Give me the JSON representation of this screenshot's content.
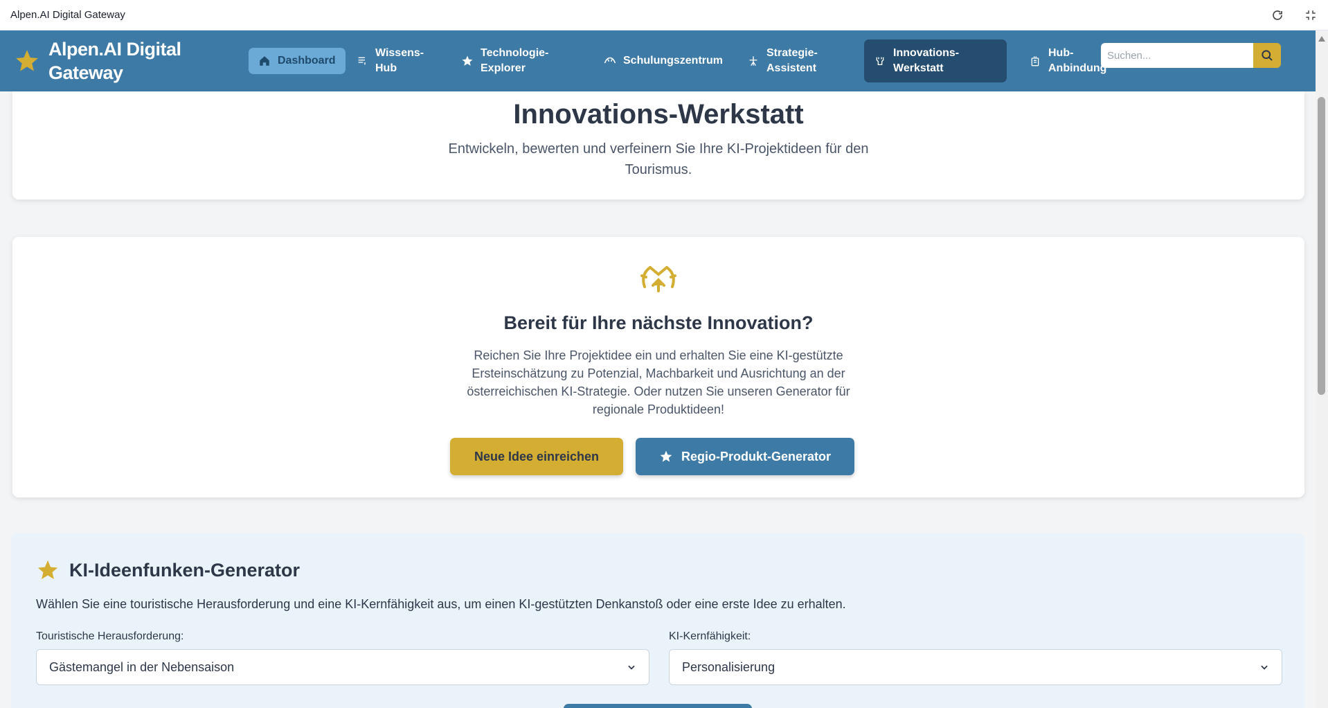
{
  "window": {
    "title": "Alpen.AI Digital Gateway"
  },
  "brand": {
    "name": "Alpen.AI Digital Gateway"
  },
  "nav": {
    "items": [
      {
        "label": "Dashboard",
        "icon": "home-icon"
      },
      {
        "label": "Wissens-Hub",
        "icon": "book-icon"
      },
      {
        "label": "Technologie-Explorer",
        "icon": "star-icon"
      },
      {
        "label": "Schulungszentrum",
        "icon": "graduation-icon"
      },
      {
        "label": "Strategie-Assistent",
        "icon": "compass-icon"
      },
      {
        "label": "Innovations-Werkstatt",
        "icon": "workshop-icon"
      },
      {
        "label": "Hub-Anbindung",
        "icon": "link-icon"
      }
    ]
  },
  "search": {
    "placeholder": "Suchen..."
  },
  "hero": {
    "title": "Innovations-Werkstatt",
    "subtitle": "Entwickeln, bewerten und verfeinern Sie Ihre KI-Projektideen für den Tourismus."
  },
  "cta": {
    "title": "Bereit für Ihre nächste Innovation?",
    "text": "Reichen Sie Ihre Projektidee ein und erhalten Sie eine KI-gestützte Ersteinschätzung zu Potenzial, Machbarkeit und Ausrichtung an der österreichischen KI-Strategie. Oder nutzen Sie unseren Generator für regionale Produktideen!",
    "primary_button": "Neue Idee einreichen",
    "secondary_button": "Regio-Produkt-Generator"
  },
  "generator": {
    "title": "KI-Ideenfunken-Generator",
    "description": "Wählen Sie eine touristische Herausforderung und eine KI-Kernfähigkeit aus, um einen KI-gestützten Denkanstoß oder eine erste Idee zu erhalten.",
    "challenge_label": "Touristische Herausforderung:",
    "challenge_value": "Gästemangel in der Nebensaison",
    "capability_label": "KI-Kernfähigkeit:",
    "capability_value": "Personalisierung"
  },
  "colors": {
    "navbar": "#3d7aa6",
    "accent_gold": "#d4ae32",
    "active_nav": "#254d70",
    "generator_bg": "#eaf3f9"
  }
}
